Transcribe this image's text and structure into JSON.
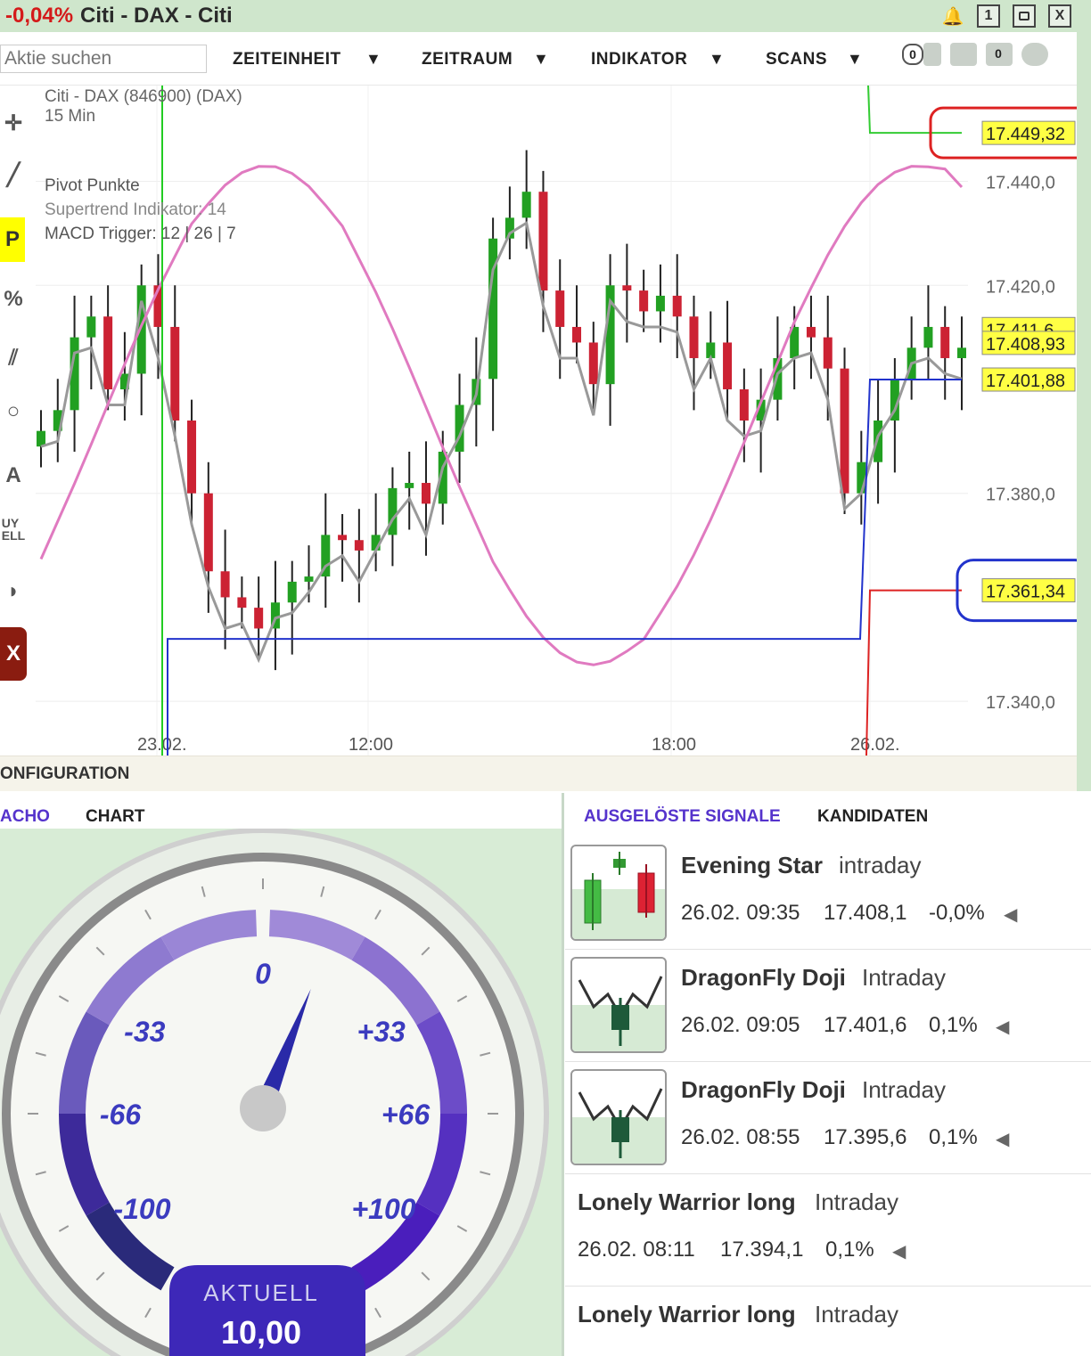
{
  "titlebar": {
    "change": "-0,04%",
    "title": "Citi - DAX - Citi",
    "buttons": [
      "1",
      "X"
    ]
  },
  "toolbar": {
    "search_placeholder": "Aktie suchen",
    "menus": [
      "ZEITEINHEIT",
      "ZEITRAUM",
      "INDIKATOR",
      "SCANS"
    ],
    "badge_left": "0",
    "badge_right": "0"
  },
  "left_tools": [
    "P",
    "%",
    "A",
    "UY\nELL",
    "X"
  ],
  "chart": {
    "instrument": "Citi - DAX (846900) (DAX)",
    "interval": "15 Min",
    "indicators": [
      "Pivot Punkte",
      "Supertrend Indikator: 14",
      "MACD Trigger: 12 | 26 | 7"
    ],
    "x_labels": [
      "23.02.",
      "12:00",
      "18:00",
      "26.02."
    ],
    "y_labels": [
      "17.440,0",
      "17.420,0",
      "17.380,0",
      "17.340,0"
    ],
    "price_tags": [
      "17.449,32",
      "17.411,6",
      "17.408,93",
      "17.401,88",
      "17.361,34"
    ],
    "colors": {
      "up": "#22a022",
      "down": "#cc2233",
      "supertrend": "#999999",
      "macd": "#e07ac0",
      "pivot": "#2233cc",
      "resistance": "#33cc33",
      "support": "#dd2222"
    }
  },
  "chart_data": {
    "type": "candlestick",
    "title": "Citi - DAX (846900) (DAX)",
    "interval": "15 Min",
    "x_ticks": [
      "23.02.",
      "12:00",
      "18:00",
      "26.02."
    ],
    "y_ticks": [
      17440.0,
      17420.0,
      17380.0,
      17340.0
    ],
    "ylim": [
      17333,
      17455
    ],
    "levels": {
      "resistance": 17449.32,
      "support": 17361.34,
      "last": 17408.93,
      "pivot": 17401.88,
      "previous_pivot": 17352.0
    },
    "close_series": [
      17392,
      17396,
      17410,
      17414,
      17400,
      17403,
      17420,
      17412,
      17394,
      17380,
      17365,
      17360,
      17358,
      17354,
      17359,
      17363,
      17364,
      17372,
      17371,
      17369,
      17372,
      17381,
      17382,
      17378,
      17388,
      17397,
      17402,
      17429,
      17433,
      17438,
      17419,
      17412,
      17409,
      17401,
      17420,
      17419,
      17415,
      17418,
      17414,
      17406,
      17409,
      17400,
      17394,
      17398,
      17406,
      17412,
      17410,
      17404,
      17380,
      17386,
      17394,
      17402,
      17408,
      17412,
      17406,
      17408
    ]
  },
  "config_label": "ONFIGURATION",
  "tabs_left": [
    "ACHO",
    "CHART"
  ],
  "tabs_right": [
    "AUSGELÖSTE SIGNALE",
    "KANDIDATEN"
  ],
  "gauge": {
    "labels": [
      "-100",
      "-66",
      "-33",
      "0",
      "+33",
      "+66",
      "+100"
    ],
    "aktuell_label": "AKTUELL",
    "value": "10,00",
    "needle_value": 10
  },
  "signals": [
    {
      "name": "Evening Star",
      "type": "intraday",
      "date": "26.02. 09:35",
      "price": "17.408,1",
      "change": "-0,0%",
      "icon": "evening-star-icon"
    },
    {
      "name": "DragonFly Doji",
      "type": "Intraday",
      "date": "26.02. 09:05",
      "price": "17.401,6",
      "change": "0,1%",
      "icon": "dragonfly-doji-icon"
    },
    {
      "name": "DragonFly Doji",
      "type": "Intraday",
      "date": "26.02. 08:55",
      "price": "17.395,6",
      "change": "0,1%",
      "icon": "dragonfly-doji-icon"
    },
    {
      "name": "Lonely Warrior long",
      "type": "Intraday",
      "date": "26.02. 08:11",
      "price": "17.394,1",
      "change": "0,1%",
      "icon": ""
    },
    {
      "name": "Lonely Warrior long",
      "type": "Intraday",
      "date": "",
      "price": "",
      "change": "",
      "icon": ""
    }
  ]
}
